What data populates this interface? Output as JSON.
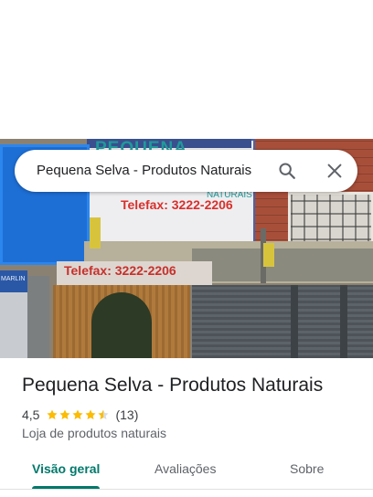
{
  "place": {
    "search_query": "Pequena Selva - Produtos Naturais",
    "name": "Pequena Selva - Produtos Naturais",
    "rating": "4,5",
    "rating_stars": 4.5,
    "review_count": "(13)",
    "category": "Loja de produtos naturais"
  },
  "photo": {
    "sign_text": "PEQUENA",
    "sign_sub": "NATURAIS",
    "telefax_upper": "Telefax: 3222-2206",
    "telefax_lower": "Telefax:   3222-2206",
    "left_store_sign": "MARLIN"
  },
  "tabs": [
    {
      "label": "Visão geral",
      "active": true
    },
    {
      "label": "Avaliações",
      "active": false
    },
    {
      "label": "Sobre",
      "active": false
    }
  ],
  "colors": {
    "accent": "#00796b",
    "star": "#fbbc04",
    "star_empty": "#dadce0"
  },
  "icons": {
    "search": "search-icon",
    "close": "close-icon",
    "star": "star-icon"
  }
}
